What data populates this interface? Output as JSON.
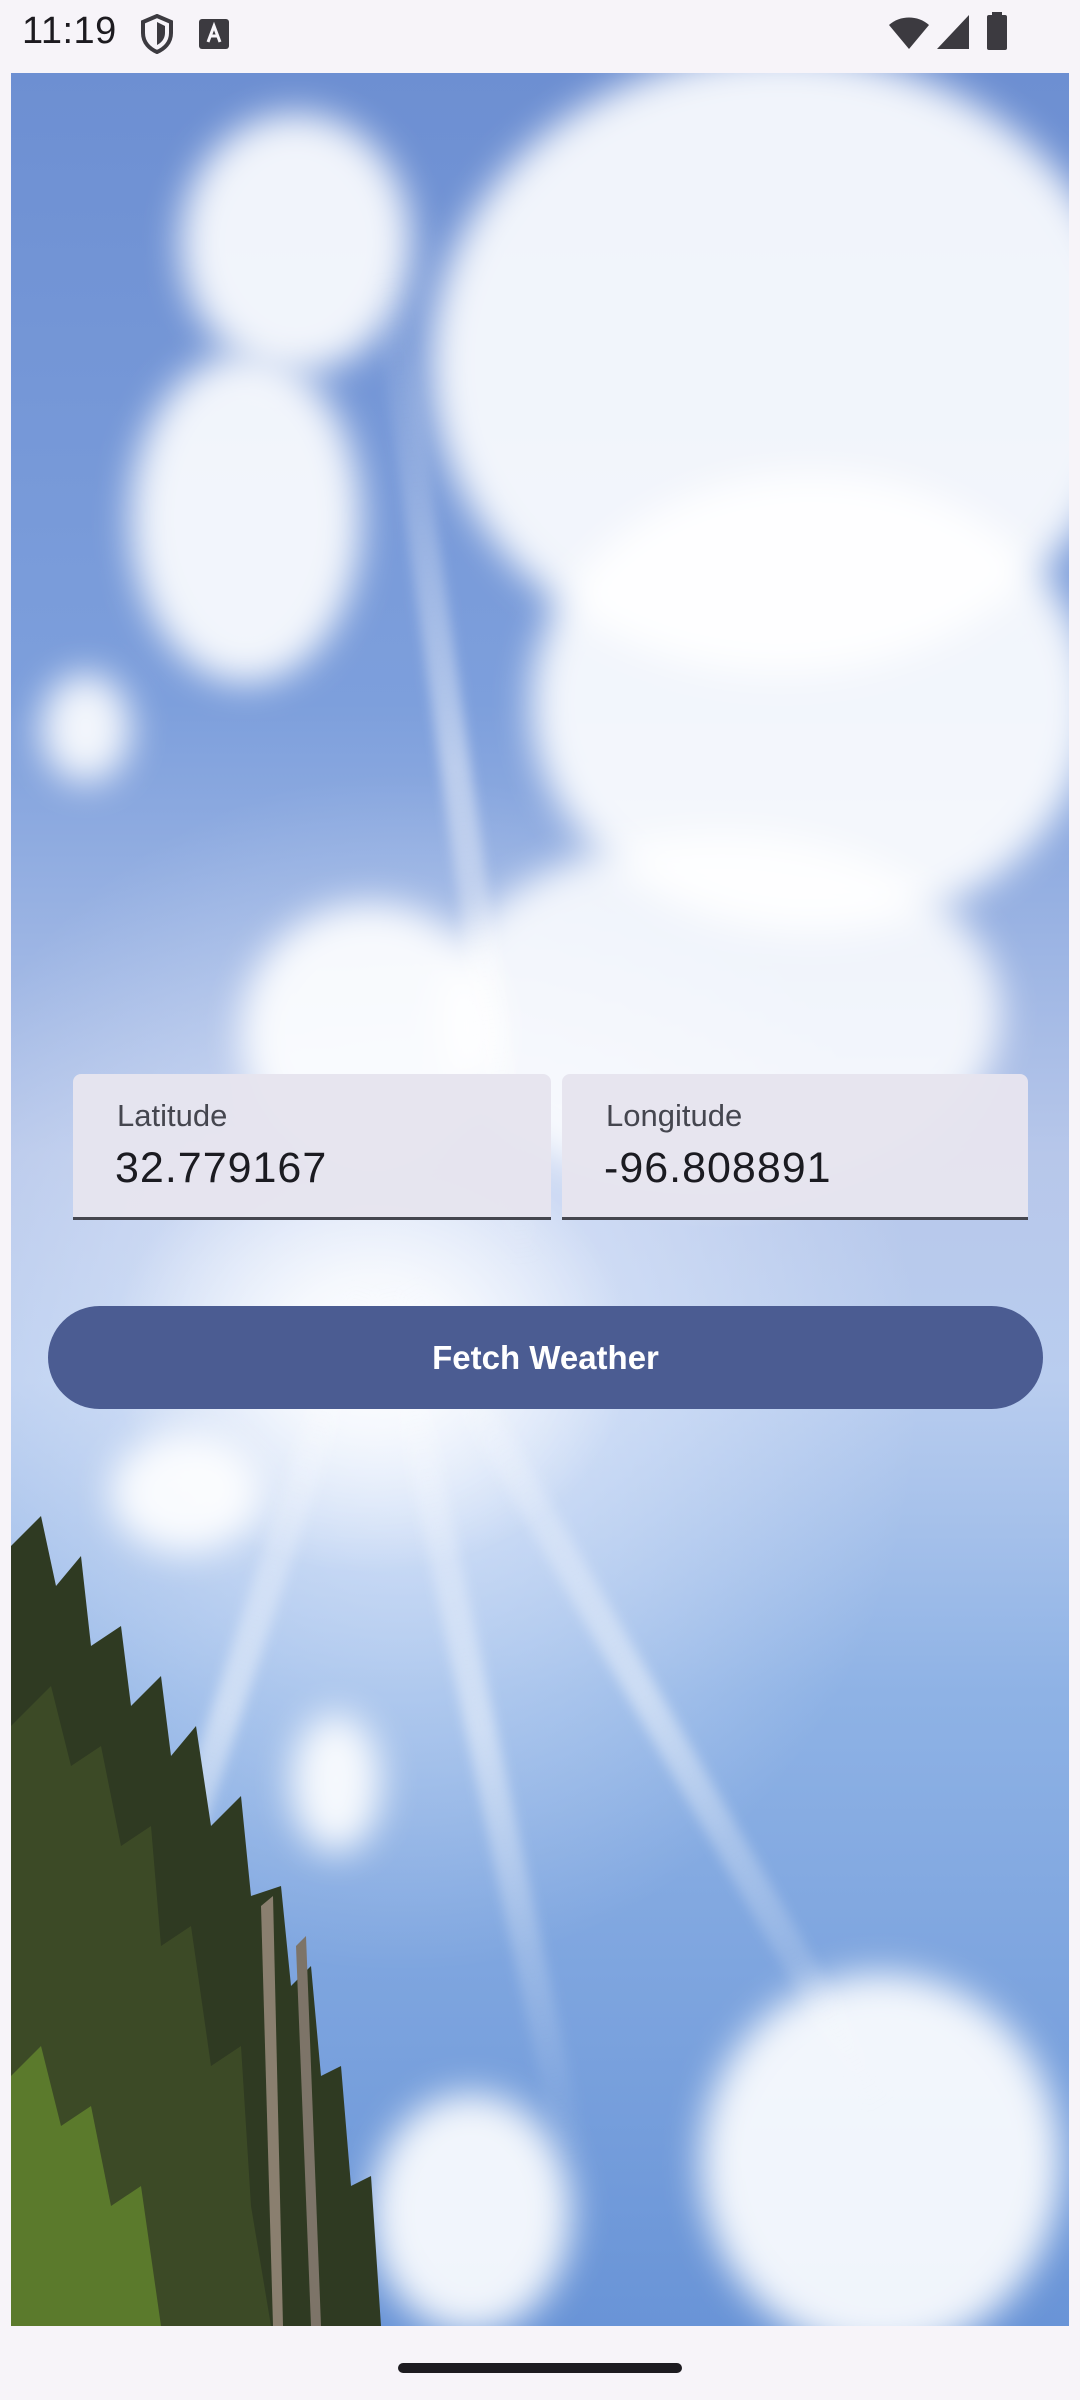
{
  "status_bar": {
    "time": "11:19",
    "left_icons": [
      "shield-icon",
      "keyboard-a-icon"
    ],
    "right_icons": [
      "wifi-icon",
      "cell-signal-icon",
      "battery-icon"
    ]
  },
  "background": {
    "icon": "sky-background"
  },
  "form": {
    "latitude": {
      "label": "Latitude",
      "value": "32.779167"
    },
    "longitude": {
      "label": "Longitude",
      "value": "-96.808891"
    },
    "fetch_button": "Fetch Weather"
  },
  "colors": {
    "button": "#4b5c92",
    "field_bg": "#e6e4ee",
    "status_bg": "#f7f4f9"
  }
}
